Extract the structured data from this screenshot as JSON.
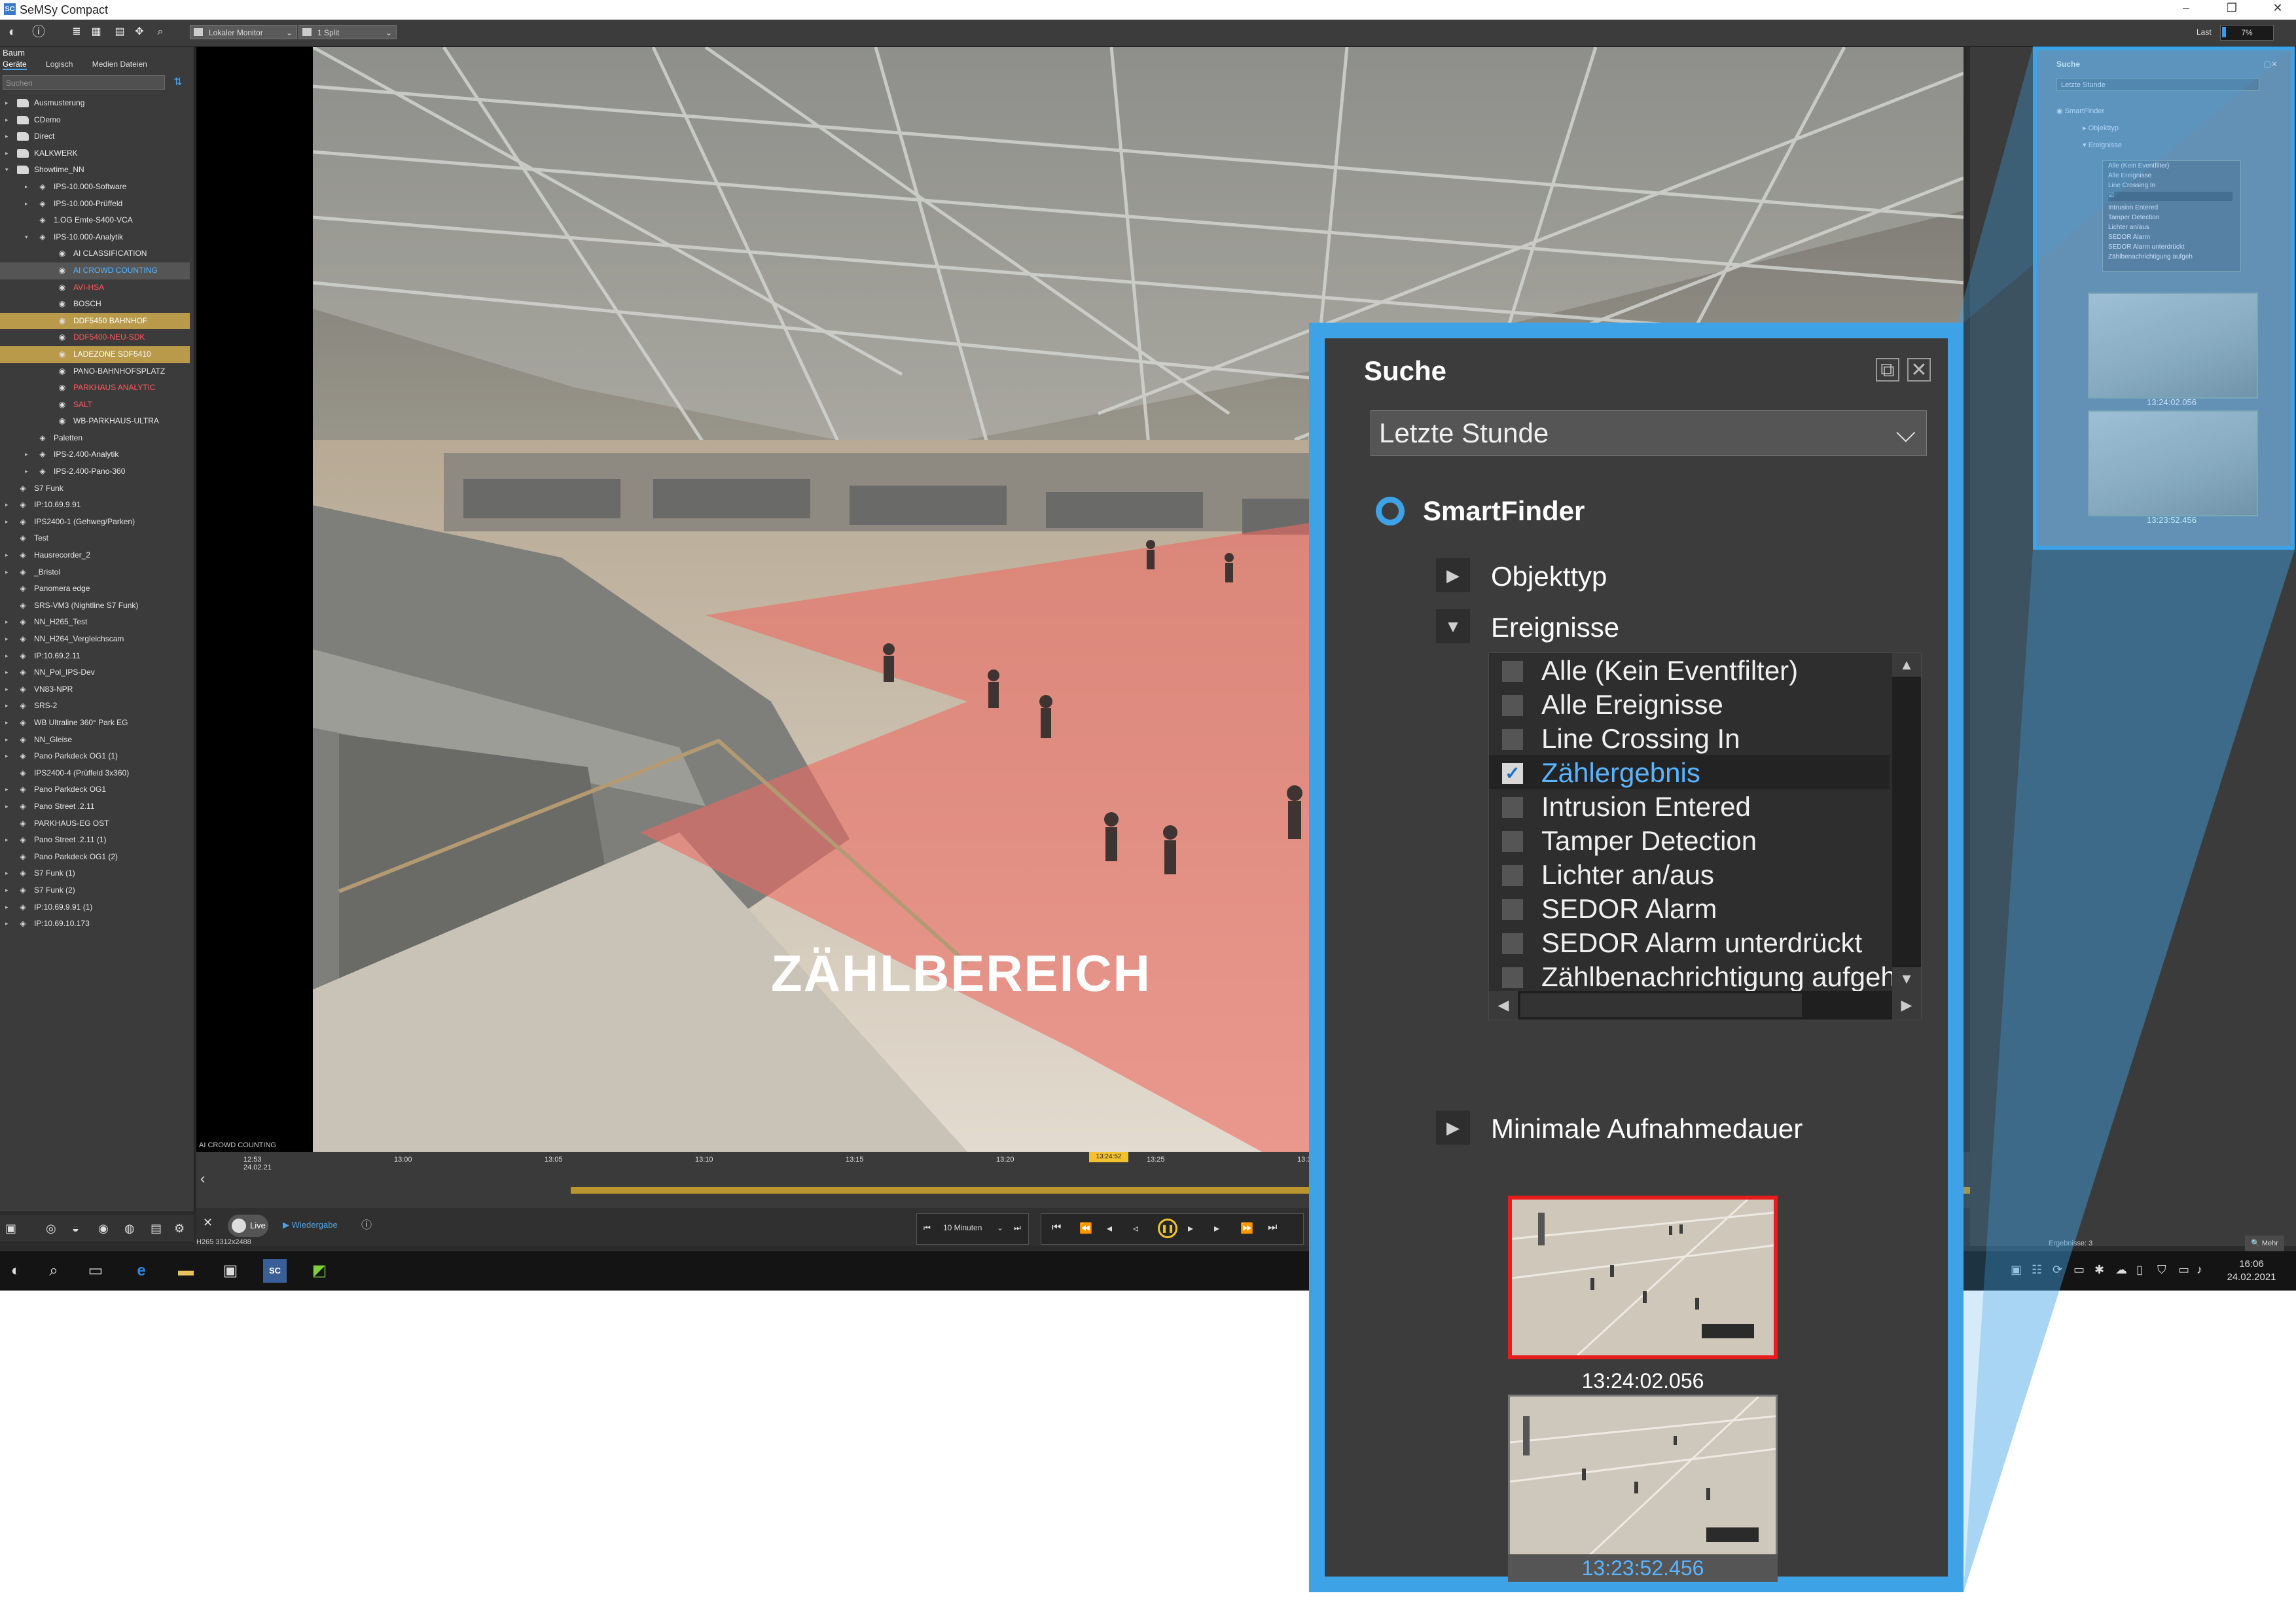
{
  "app": {
    "title": "SeMSy Compact",
    "icon_label": "SC",
    "window_controls": [
      "–",
      "❐",
      "✕"
    ]
  },
  "toolbar": {
    "monitor_select": "Lokaler Monitor",
    "split_select": "1 Split",
    "last_label": "Last",
    "last_value": "7%",
    "last_fraction": 0.07
  },
  "left_panel": {
    "header": "Baum",
    "tabs": [
      "Geräte",
      "Logisch",
      "Medien Dateien"
    ],
    "search_placeholder": "Suchen",
    "tree": [
      {
        "label": "Ausmusterung",
        "depth": 0,
        "icon": "folder-icon",
        "toggle": "▸",
        "state": ""
      },
      {
        "label": "CDemo",
        "depth": 0,
        "icon": "folder-icon",
        "toggle": "▸",
        "state": ""
      },
      {
        "label": "Direct",
        "depth": 0,
        "icon": "folder-icon",
        "toggle": "▸",
        "state": ""
      },
      {
        "label": "KALKWERK",
        "depth": 0,
        "icon": "folder-icon",
        "toggle": "▸",
        "state": ""
      },
      {
        "label": "Showtime_NN",
        "depth": 0,
        "icon": "folder-icon",
        "toggle": "▾",
        "state": ""
      },
      {
        "label": "IPS-10.000-Software",
        "depth": 1,
        "icon": "device-icon",
        "toggle": "▸",
        "state": ""
      },
      {
        "label": "IPS-10.000-Prüffeld",
        "depth": 1,
        "icon": "device-icon",
        "toggle": "▸",
        "state": ""
      },
      {
        "label": "1.OG Emte-S400-VCA",
        "depth": 1,
        "icon": "device-icon",
        "toggle": "",
        "state": ""
      },
      {
        "label": "IPS-10.000-Analytik",
        "depth": 1,
        "icon": "device-icon",
        "toggle": "▾",
        "state": ""
      },
      {
        "label": "AI CLASSIFICATION",
        "depth": 2,
        "icon": "camera-icon",
        "toggle": "",
        "state": ""
      },
      {
        "label": "AI CROWD COUNTING",
        "depth": 2,
        "icon": "camera-icon",
        "toggle": "",
        "state": "blue"
      },
      {
        "label": "AVI-HSA",
        "depth": 2,
        "icon": "camera-icon",
        "toggle": "",
        "state": "red"
      },
      {
        "label": "BOSCH",
        "depth": 2,
        "icon": "camera-icon",
        "toggle": "",
        "state": ""
      },
      {
        "label": "DDF5450 BAHNHOF",
        "depth": 2,
        "icon": "camera-icon",
        "toggle": "",
        "state": "yellow"
      },
      {
        "label": "DDF5400-NEU-SDK",
        "depth": 2,
        "icon": "camera-icon",
        "toggle": "",
        "state": "red"
      },
      {
        "label": "LADEZONE SDF5410",
        "depth": 2,
        "icon": "camera-icon",
        "toggle": "",
        "state": "yellow"
      },
      {
        "label": "PANO-BAHNHOFSPLATZ",
        "depth": 2,
        "icon": "camera-icon",
        "toggle": "",
        "state": ""
      },
      {
        "label": "PARKHAUS ANALYTIC",
        "depth": 2,
        "icon": "camera-icon",
        "toggle": "",
        "state": "red"
      },
      {
        "label": "SALT",
        "depth": 2,
        "icon": "camera-icon",
        "toggle": "",
        "state": "red"
      },
      {
        "label": "WB-PARKHAUS-ULTRA",
        "depth": 2,
        "icon": "camera-icon",
        "toggle": "",
        "state": ""
      },
      {
        "label": "Paletten",
        "depth": 1,
        "icon": "device-icon",
        "toggle": "",
        "state": ""
      },
      {
        "label": "IPS-2.400-Analytik",
        "depth": 1,
        "icon": "device-icon",
        "toggle": "▸",
        "state": ""
      },
      {
        "label": "IPS-2.400-Pano-360",
        "depth": 1,
        "icon": "device-icon",
        "toggle": "▸",
        "state": ""
      },
      {
        "label": "S7 Funk",
        "depth": 0,
        "icon": "device-icon",
        "toggle": "",
        "state": ""
      },
      {
        "label": "IP:10.69.9.91",
        "depth": 0,
        "icon": "device-icon",
        "toggle": "▸",
        "state": ""
      },
      {
        "label": "IPS2400-1 (Gehweg/Parken)",
        "depth": 0,
        "icon": "device-icon",
        "toggle": "▸",
        "state": ""
      },
      {
        "label": "Test",
        "depth": 0,
        "icon": "device-icon",
        "toggle": "",
        "state": ""
      },
      {
        "label": "Hausrecorder_2",
        "depth": 0,
        "icon": "device-icon",
        "toggle": "▸",
        "state": ""
      },
      {
        "label": "_Bristol",
        "depth": 0,
        "icon": "device-icon",
        "toggle": "▸",
        "state": ""
      },
      {
        "label": "Panomera edge",
        "depth": 0,
        "icon": "device-icon",
        "toggle": "",
        "state": ""
      },
      {
        "label": "SRS-VM3 (Nightline S7 Funk)",
        "depth": 0,
        "icon": "device-icon",
        "toggle": "",
        "state": ""
      },
      {
        "label": "NN_H265_Test",
        "depth": 0,
        "icon": "device-icon",
        "toggle": "▸",
        "state": ""
      },
      {
        "label": "NN_H264_Vergleichscam",
        "depth": 0,
        "icon": "device-icon",
        "toggle": "▸",
        "state": ""
      },
      {
        "label": "IP:10.69.2.11",
        "depth": 0,
        "icon": "device-icon",
        "toggle": "▸",
        "state": ""
      },
      {
        "label": "NN_Pol_IPS-Dev",
        "depth": 0,
        "icon": "device-icon",
        "toggle": "▸",
        "state": ""
      },
      {
        "label": "VN83-NPR",
        "depth": 0,
        "icon": "device-icon",
        "toggle": "▸",
        "state": ""
      },
      {
        "label": "SRS-2",
        "depth": 0,
        "icon": "device-icon",
        "toggle": "▸",
        "state": ""
      },
      {
        "label": "WB Ultraline 360° Park EG",
        "depth": 0,
        "icon": "device-icon",
        "toggle": "▸",
        "state": ""
      },
      {
        "label": "NN_Gleise",
        "depth": 0,
        "icon": "device-icon",
        "toggle": "▸",
        "state": ""
      },
      {
        "label": "Pano Parkdeck OG1 (1)",
        "depth": 0,
        "icon": "device-icon",
        "toggle": "▸",
        "state": ""
      },
      {
        "label": "IPS2400-4 (Prüffeld 3x360)",
        "depth": 0,
        "icon": "device-icon",
        "toggle": "",
        "state": ""
      },
      {
        "label": "Pano Parkdeck OG1",
        "depth": 0,
        "icon": "device-icon",
        "toggle": "▸",
        "state": ""
      },
      {
        "label": "Pano Street .2.11",
        "depth": 0,
        "icon": "device-icon",
        "toggle": "▸",
        "state": ""
      },
      {
        "label": "PARKHAUS-EG OST",
        "depth": 0,
        "icon": "device-icon",
        "toggle": "",
        "state": ""
      },
      {
        "label": "Pano Street .2.11 (1)",
        "depth": 0,
        "icon": "device-icon",
        "toggle": "▸",
        "state": ""
      },
      {
        "label": "Pano Parkdeck OG1 (2)",
        "depth": 0,
        "icon": "device-icon",
        "toggle": "",
        "state": ""
      },
      {
        "label": "S7 Funk (1)",
        "depth": 0,
        "icon": "device-icon",
        "toggle": "▸",
        "state": ""
      },
      {
        "label": "S7 Funk (2)",
        "depth": 0,
        "icon": "device-icon",
        "toggle": "▸",
        "state": ""
      },
      {
        "label": "IP:10.69.9.91 (1)",
        "depth": 0,
        "icon": "device-icon",
        "toggle": "▸",
        "state": ""
      },
      {
        "label": "IP:10.69.10.173",
        "depth": 0,
        "icon": "device-icon",
        "toggle": "▸",
        "state": ""
      }
    ]
  },
  "video": {
    "camera_label": "AI CROWD COUNTING",
    "zone_label": "ZÄHLBEREICH"
  },
  "timeline": {
    "ticks": [
      "12:53\n24.02.21",
      "13:00",
      "13:05",
      "13:10",
      "13:15",
      "13:20",
      "13:25",
      "13:30"
    ],
    "cursor_time": "13:24:52"
  },
  "controls": {
    "live_label": "Live",
    "playback_label": "Wiedergabe",
    "codec_info": "H265  3312x2488",
    "duration_select": "10 Minuten"
  },
  "right_panel": {
    "results_label": "Ergebnisse: 3",
    "more_button": "Mehr"
  },
  "taskbar": {
    "time": "16:06",
    "date": "24.02.2021"
  },
  "search": {
    "title": "Suche",
    "range_select": "Letzte Stunde",
    "mode_label": "SmartFinder",
    "section_object": "Objekttyp",
    "section_events": "Ereignisse",
    "section_duration": "Minimale Aufnahmedauer",
    "events": [
      {
        "label": "Alle (Kein Eventfilter)",
        "checked": false
      },
      {
        "label": "Alle Ereignisse",
        "checked": false
      },
      {
        "label": "Line Crossing In",
        "checked": false
      },
      {
        "label": "Zählergebnis",
        "checked": true
      },
      {
        "label": "Intrusion Entered",
        "checked": false
      },
      {
        "label": "Tamper Detection",
        "checked": false
      },
      {
        "label": "Lichter an/aus",
        "checked": false
      },
      {
        "label": "SEDOR Alarm",
        "checked": false
      },
      {
        "label": "SEDOR Alarm unterdrückt",
        "checked": false
      },
      {
        "label": "Zählbenachrichtigung aufgeh",
        "checked": false
      }
    ],
    "results": [
      {
        "time": "13:24:02.056",
        "selected": true
      },
      {
        "time": "13:23:52.456",
        "selected": false
      }
    ]
  },
  "colors": {
    "accent": "#3ea3e6",
    "selected_text": "#5ab4ff",
    "alarm_red": "#e81c1c",
    "zone_fill": "#ef6b63",
    "timeline_gold": "#b8952e"
  }
}
